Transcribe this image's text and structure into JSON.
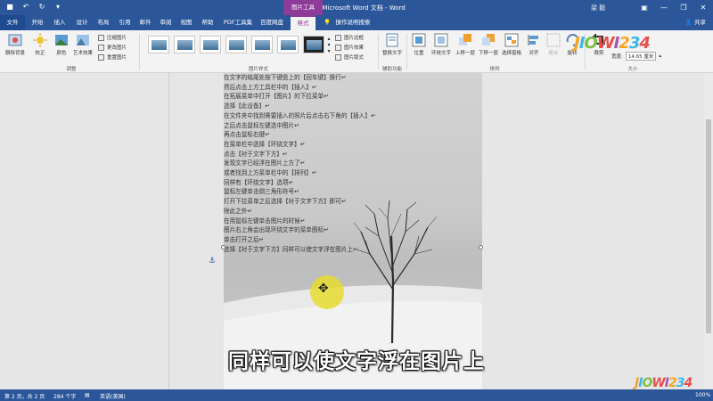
{
  "titlebar": {
    "title": "新建 Microsoft Word 文档 - Word",
    "user": "梁 毅",
    "context_header": "图片工具"
  },
  "tabs": [
    {
      "label": "文件"
    },
    {
      "label": "开始"
    },
    {
      "label": "插入"
    },
    {
      "label": "设计"
    },
    {
      "label": "布局"
    },
    {
      "label": "引用"
    },
    {
      "label": "邮件"
    },
    {
      "label": "审阅"
    },
    {
      "label": "视图"
    },
    {
      "label": "帮助"
    },
    {
      "label": "PDF工具集"
    },
    {
      "label": "百度网盘"
    },
    {
      "label": "格式"
    }
  ],
  "tell_me": "操作说明搜索",
  "share": "共享",
  "ribbon": {
    "remove_bg": "删除背景",
    "correct": "校正",
    "color": "颜色",
    "art_effects": "艺术效果",
    "compress": "压缩图片",
    "change": "更改图片",
    "reset": "重置图片",
    "adjust_group": "调整",
    "border": "图片边框",
    "effects": "图片效果",
    "layout": "图片版式",
    "styles_group": "图片样式",
    "alt_text": "替换文字",
    "accessibility_group": "辅助功能",
    "position": "位置",
    "wrap": "环绕文字",
    "forward": "上移一层",
    "backward": "下移一层",
    "selection_pane": "选择窗格",
    "align": "对齐",
    "group": "组合",
    "rotate": "旋转",
    "arrange_group": "排列",
    "crop": "裁剪",
    "height_label": "",
    "width_label": "宽度:",
    "width_value": "14.65 厘米",
    "size_group": "大小"
  },
  "document": {
    "lines": [
      "在文字的结尾处按下键盘上的【回车键】换行↵",
      "然后点击上方工具栏中的【插入】↵",
      "在拓展菜单中打开【图片】的下拉菜单↵",
      "选择【此设备】↵",
      "在文件夹中找到需要插入的照片后点击右下角的【插入】↵",
      "之后点击鼠标左键选中图片↵",
      "再点击鼠标右键↵",
      "在菜单栏中选择【环绕文字】↵",
      "点击【衬于文字下方】↵",
      "发现文字已经浮在图片上方了↵",
      "或者找到上方菜单栏中的【排列】↵",
      "同样有【环绕文字】选项↵",
      "鼠标左键单击倒三角形符号↵",
      "打开下拉菜单之后选择【衬于文字下方】即可↵",
      "除此之外↵",
      "在用鼠标左键单击图片的时候↵",
      "图片右上角会出现环绕文字的菜单图标↵",
      "单击打开之后↵",
      "选择【衬于文字下方】同样可以使文字浮在图片上↵"
    ]
  },
  "subtitle": "同样可以使文字浮在图片上",
  "status": {
    "page": "第 2 页，共 2 页",
    "words": "284 个字",
    "lang": "英语(美国)",
    "zoom": "100%"
  },
  "watermark": "JIOWI234",
  "colors": {
    "accent": "#2b579a",
    "context": "#8e3b9a"
  }
}
